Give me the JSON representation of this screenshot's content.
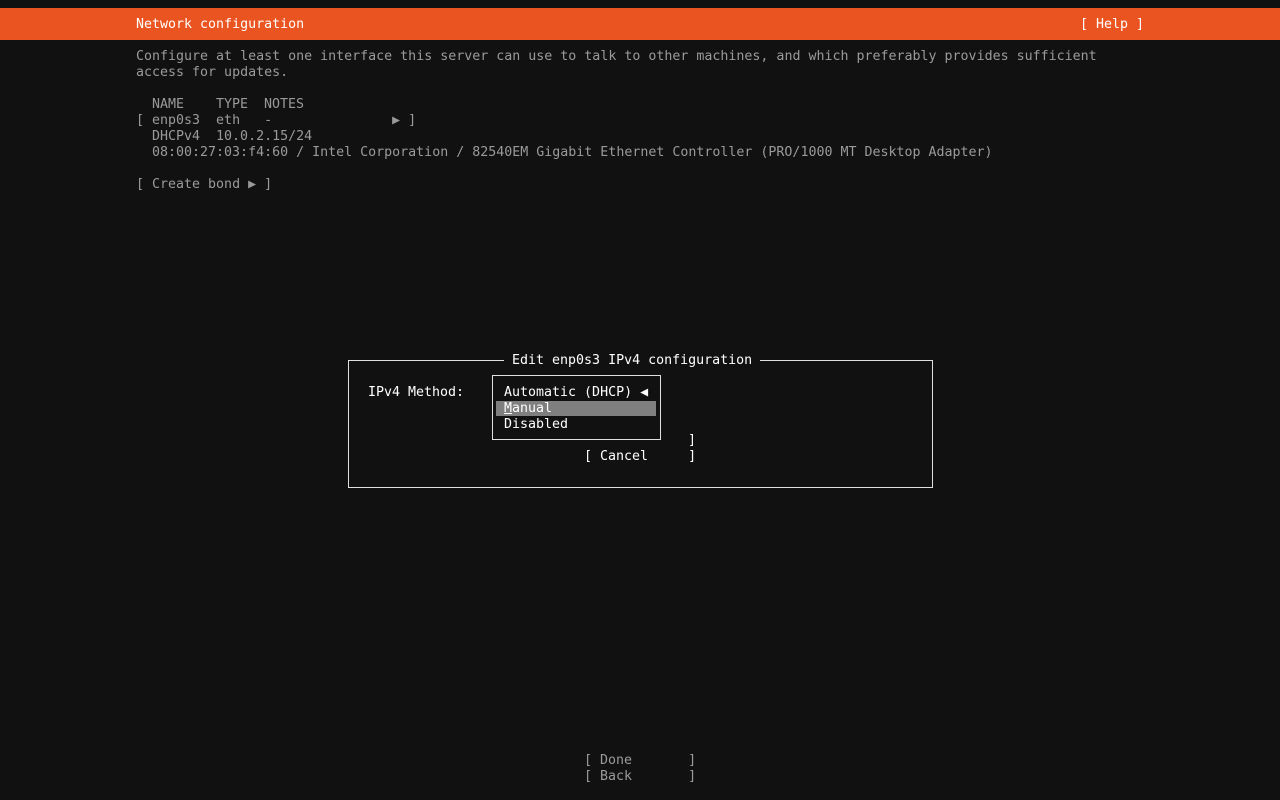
{
  "header": {
    "title": "Network configuration",
    "help_label": "[ Help ]"
  },
  "colors": {
    "accent": "#E95420",
    "background": "#111111",
    "highlight": "#7f7f7f"
  },
  "intro": [
    "Configure at least one interface this server can use to talk to other machines, and which preferably provides sufficient",
    "access for updates."
  ],
  "table": {
    "headers": [
      "NAME",
      "TYPE",
      "NOTES"
    ],
    "interface": {
      "name": "enp0s3",
      "type": "eth",
      "notes": "-",
      "row_text": "[ enp0s3  eth   -               ▶ ]"
    },
    "address_row": "DHCPv4  10.0.2.15/24",
    "hw_row": "08:00:27:03:f4:60 / Intel Corporation / 82540EM Gigabit Ethernet Controller (PRO/1000 MT Desktop Adapter)"
  },
  "create_bond": "[ Create bond ▶ ]",
  "dialog": {
    "title": "Edit enp0s3 IPv4 configuration",
    "method_label": "IPv4 Method:",
    "options": [
      "Automatic (DHCP)",
      "Manual",
      "Disabled"
    ],
    "selected": "Automatic (DHCP)",
    "selected_marker": "◀",
    "highlighted": "Manual",
    "hidden_button_bracket": "]",
    "cancel_label": "[ Cancel     ]"
  },
  "footer": {
    "done_label": "[ Done       ]",
    "back_label": "[ Back       ]"
  }
}
